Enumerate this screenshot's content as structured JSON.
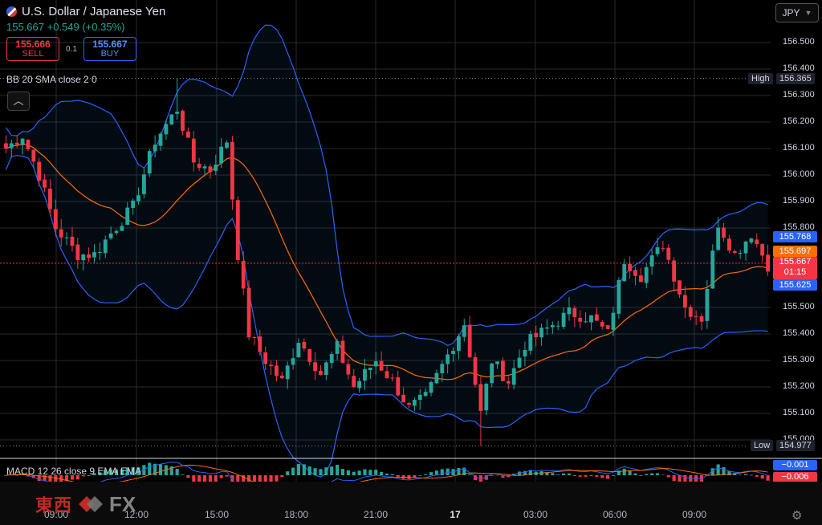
{
  "symbol": {
    "name": "U.S. Dollar / Japanese Yen",
    "last": "155.667",
    "change": "+0.549",
    "change_pct": "(+0.35%)"
  },
  "trade": {
    "sell_price": "155.666",
    "sell_label": "SELL",
    "spread": "0.1",
    "buy_price": "155.667",
    "buy_label": "BUY"
  },
  "currency_button": "JPY",
  "indicators": {
    "bb": "BB 20 SMA close 2 0",
    "macd": "MACD 12 26 close 9 EMA EMA",
    "macd_value_1": "−0.001",
    "macd_value_2": "−0.006"
  },
  "price_axis": {
    "ticks": [
      "156.500",
      "156.400",
      "156.300",
      "156.200",
      "156.100",
      "156.000",
      "155.900",
      "155.800",
      "155.500",
      "155.400",
      "155.300",
      "155.200",
      "155.100",
      "155.000"
    ],
    "high_label": "High",
    "high_value": "156.365",
    "low_label": "Low",
    "low_value": "154.977",
    "bb_upper": "155.768",
    "bb_basis": "155.697",
    "current_price": "155.667",
    "countdown": "01:15",
    "bb_lower": "155.625"
  },
  "time_axis": [
    "09:00",
    "12:00",
    "15:00",
    "18:00",
    "21:00",
    "17",
    "03:00",
    "06:00",
    "09:00"
  ],
  "watermark": {
    "cn": "東西",
    "fx": "FX"
  },
  "colors": {
    "up": "#26a69a",
    "down": "#f23645",
    "band": "#2962ff",
    "basis": "#ff6d00",
    "grid": "#2a2a2a"
  },
  "chart_data": {
    "type": "candlestick",
    "ylim": [
      154.977,
      156.365
    ],
    "x_labels": [
      "09:00",
      "12:00",
      "15:00",
      "18:00",
      "21:00",
      "17",
      "03:00",
      "06:00",
      "09:00"
    ],
    "close_anchors": [
      [
        0,
        156.1
      ],
      [
        3,
        156.15
      ],
      [
        6,
        156.0
      ],
      [
        9,
        155.8
      ],
      [
        13,
        155.7
      ],
      [
        16,
        155.7
      ],
      [
        19,
        155.78
      ],
      [
        23,
        155.88
      ],
      [
        27,
        156.13
      ],
      [
        31,
        156.25
      ],
      [
        34,
        156.05
      ],
      [
        37,
        156.02
      ],
      [
        40,
        156.13
      ],
      [
        42,
        155.7
      ],
      [
        44,
        155.4
      ],
      [
        47,
        155.3
      ],
      [
        50,
        155.22
      ],
      [
        53,
        155.38
      ],
      [
        57,
        155.25
      ],
      [
        60,
        155.35
      ],
      [
        63,
        155.2
      ],
      [
        67,
        155.3
      ],
      [
        70,
        155.22
      ],
      [
        73,
        155.12
      ],
      [
        76,
        155.16
      ],
      [
        80,
        155.32
      ],
      [
        83,
        155.44
      ],
      [
        86,
        155.1
      ],
      [
        88,
        155.3
      ],
      [
        91,
        155.22
      ],
      [
        94,
        155.36
      ],
      [
        98,
        155.42
      ],
      [
        102,
        155.48
      ],
      [
        106,
        155.46
      ],
      [
        109,
        155.4
      ],
      [
        112,
        155.68
      ],
      [
        115,
        155.62
      ],
      [
        119,
        155.74
      ],
      [
        123,
        155.5
      ],
      [
        126,
        155.46
      ],
      [
        129,
        155.82
      ],
      [
        132,
        155.7
      ],
      [
        135,
        155.78
      ],
      [
        138,
        155.66
      ]
    ],
    "high": 156.365,
    "low": 154.977,
    "bb_upper_last": 155.768,
    "bb_basis_last": 155.697,
    "bb_lower_last": 155.625,
    "macd_last": -0.001,
    "signal_last": -0.006
  }
}
